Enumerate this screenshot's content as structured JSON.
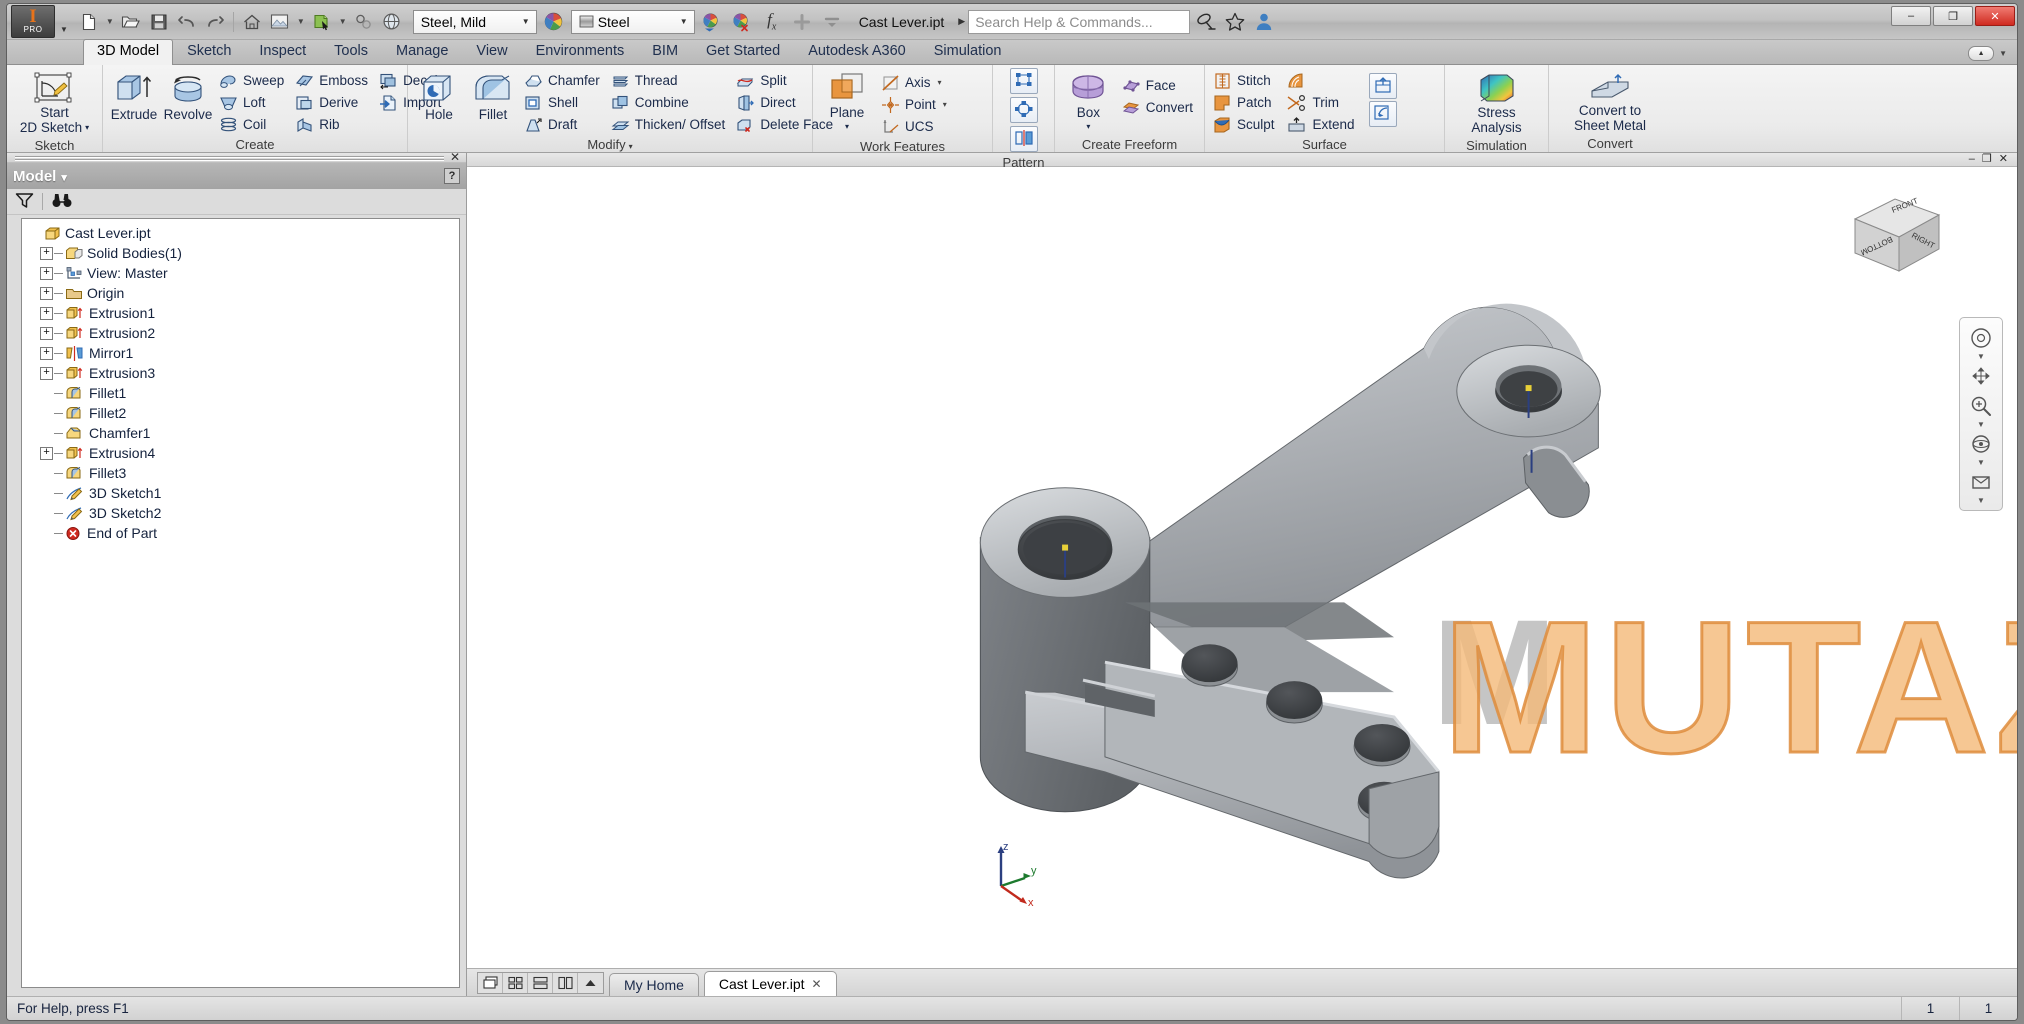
{
  "window": {
    "document_title": "Cast Lever.ipt",
    "minimize_label": "–",
    "restore_label": "❐",
    "close_label": "✕"
  },
  "app_menu": {
    "glyph": "I",
    "sub": "PRO"
  },
  "quick_access": [
    {
      "name": "new-document",
      "icon": "page-icon",
      "has_caret": true
    },
    {
      "name": "open-document",
      "icon": "folder-open-icon",
      "has_caret": false
    },
    {
      "name": "save-document",
      "icon": "floppy-disk-icon",
      "has_caret": false
    },
    {
      "name": "undo",
      "icon": "undo-arrow-icon",
      "has_caret": false
    },
    {
      "name": "redo",
      "icon": "redo-arrow-icon",
      "has_caret": false
    },
    {
      "name": "home-view",
      "icon": "home-icon",
      "has_caret": false
    },
    {
      "name": "appearance-swatch",
      "icon": "picture-icon",
      "has_caret": true
    },
    {
      "name": "select-mode",
      "icon": "select-cursor-icon",
      "has_caret": true
    },
    {
      "name": "return-to-parent",
      "icon": "link-circles-icon",
      "has_caret": false
    },
    {
      "name": "globe-view",
      "icon": "globe-icon",
      "has_caret": false
    }
  ],
  "material_combo": {
    "value": "Steel, Mild"
  },
  "appearance_combo": {
    "value": "Steel"
  },
  "qat_right": [
    {
      "name": "appearance-apply",
      "icon": "color-wheel-down-icon"
    },
    {
      "name": "appearance-clear",
      "icon": "color-wheel-x-icon"
    },
    {
      "name": "parameters",
      "icon": "fx-icon"
    },
    {
      "name": "customize-qat-add",
      "icon": "plus-icon"
    },
    {
      "name": "customize-qat-menu",
      "icon": "bar-caret-icon"
    }
  ],
  "search": {
    "placeholder": "Search Help & Commands...",
    "expand_arrow": "▶",
    "icons": [
      {
        "name": "signin-dish-icon"
      },
      {
        "name": "favorites-star-icon"
      },
      {
        "name": "user-account-icon"
      }
    ],
    "right_icons": [
      {
        "name": "autodesk-exchange-icon"
      },
      {
        "name": "help-icon"
      }
    ]
  },
  "ribbon_tabs": [
    {
      "label": "3D Model",
      "active": true
    },
    {
      "label": "Sketch",
      "active": false
    },
    {
      "label": "Inspect",
      "active": false
    },
    {
      "label": "Tools",
      "active": false
    },
    {
      "label": "Manage",
      "active": false
    },
    {
      "label": "View",
      "active": false
    },
    {
      "label": "Environments",
      "active": false
    },
    {
      "label": "BIM",
      "active": false
    },
    {
      "label": "Get Started",
      "active": false
    },
    {
      "label": "Autodesk A360",
      "active": false
    },
    {
      "label": "Simulation",
      "active": false
    }
  ],
  "ribbon_panels": {
    "sketch": {
      "title": "Sketch",
      "big": {
        "label_line1": "Start",
        "label_line2": "2D Sketch",
        "icon": "sketch-plane-icon",
        "caret": "▾"
      }
    },
    "create": {
      "title": "Create",
      "big": [
        {
          "label": "Extrude",
          "icon": "extrude-icon"
        },
        {
          "label": "Revolve",
          "icon": "revolve-icon"
        }
      ],
      "small_col1": [
        {
          "label": "Sweep",
          "icon": "sweep-icon"
        },
        {
          "label": "Loft",
          "icon": "loft-icon"
        },
        {
          "label": "Coil",
          "icon": "coil-icon"
        }
      ],
      "small_col2": [
        {
          "label": "Emboss",
          "icon": "emboss-icon"
        },
        {
          "label": "Derive",
          "icon": "derive-icon"
        },
        {
          "label": "Rib",
          "icon": "rib-icon"
        }
      ],
      "small_col3": [
        {
          "label": "Decal",
          "icon": "decal-icon"
        },
        {
          "label": "Import",
          "icon": "import-icon"
        }
      ]
    },
    "modify": {
      "title": "Modify",
      "caret": "▾",
      "big": [
        {
          "label": "Hole",
          "icon": "hole-icon"
        },
        {
          "label": "Fillet",
          "icon": "fillet-icon"
        }
      ],
      "small_col1": [
        {
          "label": "Chamfer",
          "icon": "chamfer-icon"
        },
        {
          "label": "Shell",
          "icon": "shell-icon"
        },
        {
          "label": "Draft",
          "icon": "draft-icon"
        }
      ],
      "small_col2": [
        {
          "label": "Thread",
          "icon": "thread-icon"
        },
        {
          "label": "Combine",
          "icon": "combine-icon"
        },
        {
          "label": "Thicken/ Offset",
          "icon": "thicken-offset-icon"
        }
      ],
      "small_col3": [
        {
          "label": "Split",
          "icon": "split-icon"
        },
        {
          "label": "Direct",
          "icon": "direct-edit-icon"
        },
        {
          "label": "Delete Face",
          "icon": "delete-face-icon"
        }
      ]
    },
    "work_features": {
      "title": "Work Features",
      "big": {
        "label": "Plane",
        "icon": "work-plane-icon",
        "caret": "▾"
      },
      "small": [
        {
          "label": "Axis",
          "icon": "work-axis-icon",
          "caret": "▾"
        },
        {
          "label": "Point",
          "icon": "work-point-icon",
          "caret": "▾"
        },
        {
          "label": "UCS",
          "icon": "ucs-icon",
          "caret": ""
        }
      ]
    },
    "pattern": {
      "title": "Pattern",
      "items": [
        {
          "name": "rectangular-pattern",
          "icon": "rectangular-pattern-icon"
        },
        {
          "name": "circular-pattern",
          "icon": "circular-pattern-icon"
        },
        {
          "name": "mirror",
          "icon": "mirror-icon"
        }
      ]
    },
    "create_freeform": {
      "title": "Create Freeform",
      "big": {
        "label": "Box",
        "icon": "freeform-box-icon",
        "caret": "▾"
      },
      "small": [
        {
          "label": "Face",
          "icon": "freeform-face-icon"
        },
        {
          "label": "Convert",
          "icon": "freeform-convert-icon"
        }
      ]
    },
    "surface": {
      "title": "Surface",
      "small_col1": [
        {
          "label": "Stitch",
          "icon": "stitch-icon"
        },
        {
          "label": "Patch",
          "icon": "patch-icon"
        },
        {
          "label": "Sculpt",
          "icon": "sculpt-icon"
        }
      ],
      "small_col2": [
        {
          "label": "",
          "icon": "ruled-surface-icon"
        },
        {
          "label": "Trim",
          "icon": "trim-icon"
        },
        {
          "label": "Extend",
          "icon": "extend-icon"
        }
      ],
      "boxes": [
        {
          "name": "replace-face",
          "icon": "replace-face-icon"
        },
        {
          "name": "copy-object",
          "icon": "copy-object-icon"
        }
      ]
    },
    "simulation": {
      "title": "Simulation",
      "big": {
        "label_line1": "Stress",
        "label_line2": "Analysis",
        "icon": "stress-analysis-icon"
      }
    },
    "convert": {
      "title": "Convert",
      "big": {
        "label_line1": "Convert to",
        "label_line2": "Sheet Metal",
        "icon": "sheet-metal-icon"
      }
    }
  },
  "browser": {
    "header_title": "Model",
    "header_caret": "▾",
    "help_badge": "?",
    "close_x": "✕",
    "toolbar": [
      {
        "name": "filter-icon"
      },
      {
        "name": "find-binoculars-icon"
      }
    ],
    "tree": [
      {
        "label": "Cast Lever.ipt",
        "icon": "part-file-icon",
        "indent": 0,
        "expandable": false,
        "root": true
      },
      {
        "label": "Solid Bodies(1)",
        "icon": "solid-bodies-icon",
        "indent": 1,
        "expandable": true
      },
      {
        "label": "View: Master",
        "icon": "view-master-icon",
        "indent": 1,
        "expandable": true
      },
      {
        "label": "Origin",
        "icon": "origin-folder-icon",
        "indent": 1,
        "expandable": true
      },
      {
        "label": "Extrusion1",
        "icon": "extrusion-icon",
        "indent": 1,
        "expandable": true
      },
      {
        "label": "Extrusion2",
        "icon": "extrusion-icon",
        "indent": 1,
        "expandable": true
      },
      {
        "label": "Mirror1",
        "icon": "mirror-feature-icon",
        "indent": 1,
        "expandable": true
      },
      {
        "label": "Extrusion3",
        "icon": "extrusion-icon",
        "indent": 1,
        "expandable": true
      },
      {
        "label": "Fillet1",
        "icon": "fillet-feature-icon",
        "indent": 1,
        "expandable": false
      },
      {
        "label": "Fillet2",
        "icon": "fillet-feature-icon",
        "indent": 1,
        "expandable": false
      },
      {
        "label": "Chamfer1",
        "icon": "chamfer-feature-icon",
        "indent": 1,
        "expandable": false
      },
      {
        "label": "Extrusion4",
        "icon": "extrusion-icon",
        "indent": 1,
        "expandable": true
      },
      {
        "label": "Fillet3",
        "icon": "fillet-feature-icon",
        "indent": 1,
        "expandable": false
      },
      {
        "label": "3D Sketch1",
        "icon": "sketch3d-icon",
        "indent": 1,
        "expandable": false
      },
      {
        "label": "3D Sketch2",
        "icon": "sketch3d-icon",
        "indent": 1,
        "expandable": false
      },
      {
        "label": "End of Part",
        "icon": "end-of-part-icon",
        "indent": 1,
        "expandable": false
      }
    ]
  },
  "viewport": {
    "watermark": "MUTAZ",
    "watermark_mark": "M",
    "viewcube_faces": {
      "front": "FRONT",
      "right": "RIGHT",
      "bottom": "BOTTOM"
    },
    "axis_labels": {
      "x": "x",
      "y": "y",
      "z": "z"
    },
    "window_buttons": {
      "minimize": "–",
      "restore": "❐",
      "close": "✕"
    }
  },
  "dock": {
    "window_layout_buttons": [
      {
        "name": "cascade-windows-icon"
      },
      {
        "name": "tile-grid-icon"
      },
      {
        "name": "tile-horizontal-icon"
      },
      {
        "name": "tile-vertical-icon"
      },
      {
        "name": "scroll-tabs-up-icon"
      }
    ],
    "tabs": [
      {
        "label": "My Home",
        "active": false,
        "closable": false
      },
      {
        "label": "Cast Lever.ipt",
        "active": true,
        "closable": true,
        "close_glyph": "✕"
      }
    ]
  },
  "statusbar": {
    "message": "For Help, press F1",
    "cell1": "1",
    "cell2": "1"
  }
}
